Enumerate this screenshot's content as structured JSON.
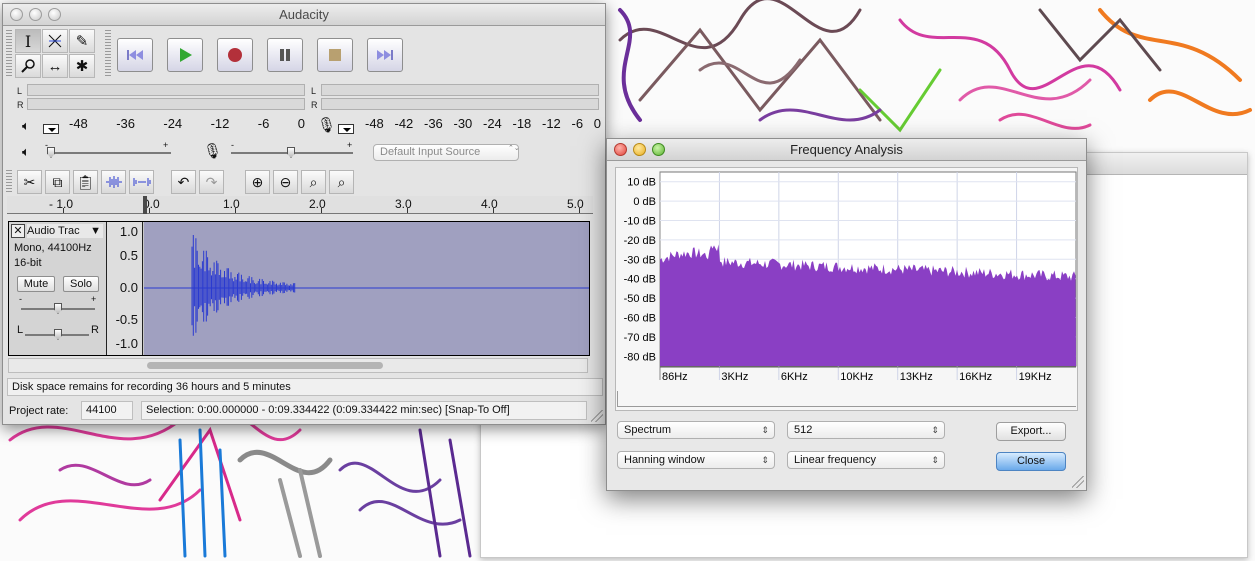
{
  "audacity": {
    "title": "Audacity",
    "tools": [
      {
        "icon": "selection-tool-icon",
        "glyph": "I"
      },
      {
        "icon": "envelope-tool-icon",
        "glyph": "⏃"
      },
      {
        "icon": "draw-tool-icon",
        "glyph": "✎"
      },
      {
        "icon": "zoom-tool-icon",
        "glyph": "⚲"
      },
      {
        "icon": "time-shift-tool-icon",
        "glyph": "↔"
      },
      {
        "icon": "multi-tool-icon",
        "glyph": "✱"
      }
    ],
    "transport": [
      "skip-to-start-icon",
      "play-icon",
      "record-icon",
      "pause-icon",
      "stop-icon",
      "skip-to-end-icon"
    ],
    "playback_meter": {
      "channels": [
        "L",
        "R"
      ],
      "scale": [
        "-48",
        "-36",
        "-24",
        "-12",
        "-6",
        "0"
      ]
    },
    "record_meter": {
      "channels": [
        "L",
        "R"
      ],
      "scale": [
        "-48",
        "-42",
        "-36",
        "-30",
        "-24",
        "-18",
        "-12",
        "-6",
        "0"
      ]
    },
    "mixer": {
      "input_source": "Default Input Source",
      "gain_signs": [
        "-",
        "+"
      ],
      "pan_signs": [
        "-",
        "+"
      ]
    },
    "timeline": {
      "labels": [
        "- 1.0",
        "0.0",
        "1.0",
        "2.0",
        "3.0",
        "4.0",
        "5.0"
      ]
    },
    "track": {
      "name": "Audio Trac",
      "format": "Mono, 44100Hz",
      "bit_depth": "16-bit",
      "mute_label": "Mute",
      "solo_label": "Solo",
      "gain_signs": [
        "-",
        "+"
      ],
      "pan_labels": [
        "L",
        "R"
      ],
      "vscale": [
        "1.0",
        "0.5",
        "0.0",
        "-0.5",
        "-1.0"
      ]
    },
    "status": "Disk space remains for recording 36 hours and 5 minutes",
    "project_rate_label": "Project rate:",
    "project_rate_value": "44100",
    "selection": "Selection: 0:00.000000 - 0:09.334422 (0:09.334422 min:sec)  [Snap-To Off]"
  },
  "freq": {
    "title": "Frequency Analysis",
    "y_labels": [
      "10 dB",
      "0 dB",
      "-10 dB",
      "-20 dB",
      "-30 dB",
      "-40 dB",
      "-50 dB",
      "-60 dB",
      "-70 dB",
      "-80 dB"
    ],
    "x_labels": [
      "86Hz",
      "3KHz",
      "6KHz",
      "10KHz",
      "13KHz",
      "16KHz",
      "19KHz"
    ],
    "algorithm": "Spectrum",
    "size": "512",
    "window": "Hanning window",
    "axis": "Linear frequency",
    "export_label": "Export...",
    "close_label": "Close",
    "fill_color": "#8a3fc4"
  }
}
